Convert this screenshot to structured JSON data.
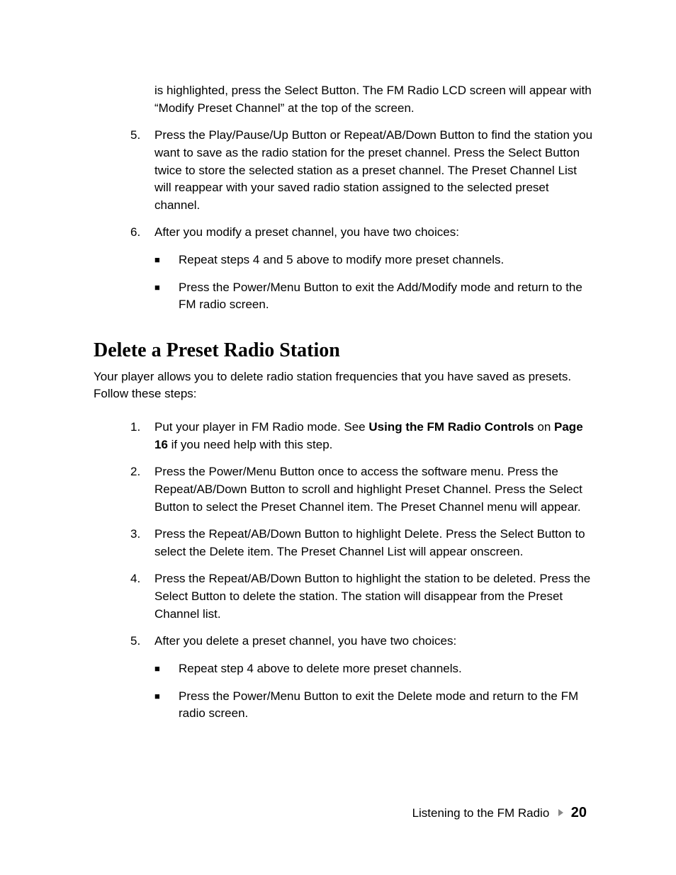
{
  "top": {
    "continuation": "is highlighted, press the Select Button. The FM Radio LCD screen will appear with “Modify Preset Channel” at the top of the screen.",
    "item5_num": "5.",
    "item5": "Press the Play/Pause/Up Button or Repeat/AB/Down Button to find the station you want to save as the radio station for the preset channel. Press the Select Button twice to store the selected station as a preset channel. The Preset Channel List will reappear with your saved radio station assigned to the selected preset channel.",
    "item6_num": "6.",
    "item6": "After you modify a preset channel, you have two choices:",
    "item6_b1": "Repeat steps 4 and 5 above to modify more preset channels.",
    "item6_b2": "Press the Power/Menu Button to exit the Add/Modify mode and return to the FM radio screen."
  },
  "section": {
    "heading": "Delete a Preset Radio Station",
    "intro": "Your player allows you to delete radio station frequencies that you have saved as presets. Follow these steps:",
    "item1_num": "1.",
    "item1_a": "Put your player in FM Radio mode. See ",
    "item1_b": "Using the FM Radio Controls",
    "item1_c": " on ",
    "item1_d": "Page 16",
    "item1_e": " if you need help with this step.",
    "item2_num": "2.",
    "item2": "Press the Power/Menu Button once to access the software menu. Press the Repeat/AB/Down Button to scroll and highlight Preset Channel. Press the Select Button to select the Preset Channel item. The Preset Channel menu will appear.",
    "item3_num": "3.",
    "item3": "Press the Repeat/AB/Down Button to highlight Delete. Press the Select Button to select the Delete item. The Preset Channel List will appear onscreen.",
    "item4_num": "4.",
    "item4": "Press the Repeat/AB/Down Button to highlight the station to be deleted. Press the Select Button to delete the station. The station will disappear from the Preset Channel list.",
    "item5_num": "5.",
    "item5": "After you delete a preset channel, you have two choices:",
    "item5_b1": "Repeat step 4 above to delete more preset channels.",
    "item5_b2": "Press the Power/Menu Button to exit the Delete mode and return to the FM radio screen."
  },
  "footer": {
    "section_name": "Listening to the FM Radio",
    "page": "20"
  },
  "glyphs": {
    "square": "■"
  }
}
